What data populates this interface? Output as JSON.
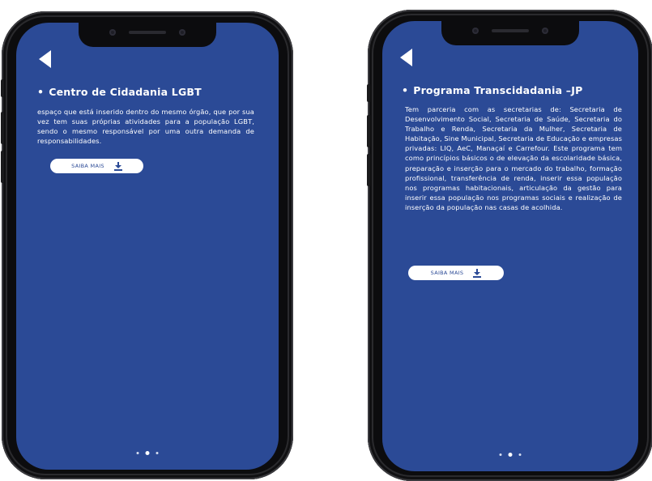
{
  "left": {
    "title": "Centro de Cidadania LGBT",
    "body": "espaço que está inserido dentro do mesmo órgão, que por sua vez tem suas próprias atividades para a população LGBT, sendo o mesmo responsável por uma outra demanda de responsabilidades.",
    "button_label": "SAIBA MAIS",
    "back_icon": "back-arrow-icon",
    "download_icon": "download-icon"
  },
  "right": {
    "title": "Programa Transcidadania –JP",
    "body": "Tem parceria com as secretarias de: Secretaria de Desenvolvimento Social, Secretaria de Saúde, Secretaria do Trabalho e Renda, Secretaria da Mulher, Secretaria de Habitação, Sine Municipal, Secretaria de Educação e empresas privadas: LIQ, AeC, Manaçaí e Carrefour. Este programa tem como princípios básicos o de elevação da escolaridade básica, preparação e inserção para o mercado do trabalho, formação profissional, transferência de renda, inserir essa população nos programas habitacionais, articulação da gestão para inserir essa população nos programas sociais e realização de inserção da população nas casas de acolhida.",
    "button_label": "SAIBA MAIS",
    "back_icon": "back-arrow-icon",
    "download_icon": "download-icon"
  },
  "bullet": "•",
  "colors": {
    "screen_bg": "#2b4a96",
    "text": "#ffffff",
    "frame": "#0c0c0e"
  },
  "pagination": {
    "left_active_index": 1,
    "right_active_index": 1,
    "count": 3
  }
}
